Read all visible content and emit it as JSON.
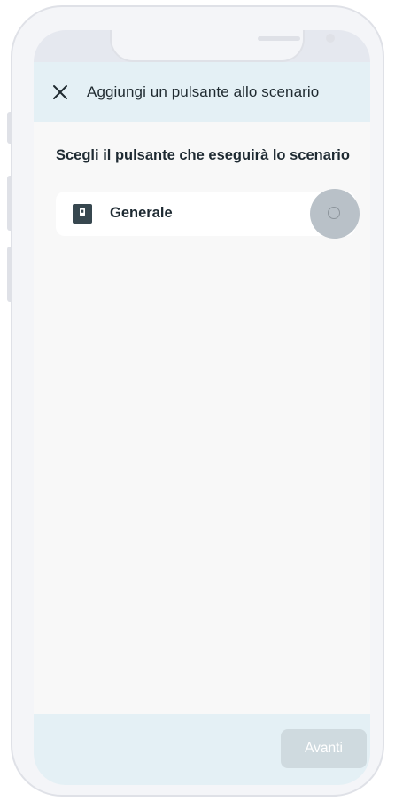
{
  "header": {
    "title": "Aggiungi un pulsante allo scenario",
    "close_icon": "close-icon"
  },
  "main": {
    "section_title": "Scegli il pulsante che eseguirà lo scenario",
    "options": [
      {
        "label": "Generale",
        "icon": "wall-switch-icon",
        "selected": false
      }
    ]
  },
  "footer": {
    "next_label": "Avanti",
    "next_enabled": false
  },
  "colors": {
    "header_bg": "#e4f0f5",
    "screen_bg": "#f8f8f8",
    "text": "#1e2a32",
    "button_disabled_bg": "#cfdadf",
    "icon": "#37474f"
  }
}
